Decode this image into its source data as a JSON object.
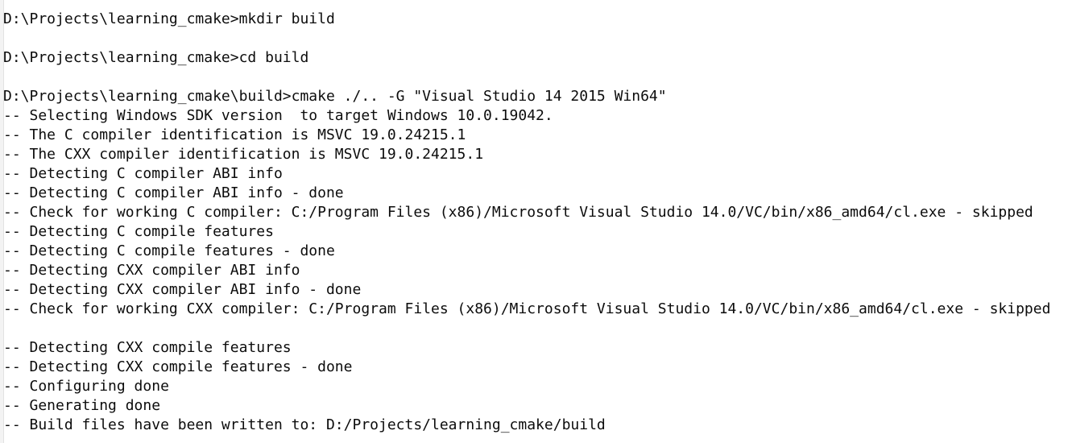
{
  "console": {
    "lines": [
      "D:\\Projects\\learning_cmake>mkdir build",
      "",
      "D:\\Projects\\learning_cmake>cd build",
      "",
      "D:\\Projects\\learning_cmake\\build>cmake ./.. -G \"Visual Studio 14 2015 Win64\"",
      "-- Selecting Windows SDK version  to target Windows 10.0.19042.",
      "-- The C compiler identification is MSVC 19.0.24215.1",
      "-- The CXX compiler identification is MSVC 19.0.24215.1",
      "-- Detecting C compiler ABI info",
      "-- Detecting C compiler ABI info - done",
      "-- Check for working C compiler: C:/Program Files (x86)/Microsoft Visual Studio 14.0/VC/bin/x86_amd64/cl.exe - skipped",
      "-- Detecting C compile features",
      "-- Detecting C compile features - done",
      "-- Detecting CXX compiler ABI info",
      "-- Detecting CXX compiler ABI info - done",
      "-- Check for working CXX compiler: C:/Program Files (x86)/Microsoft Visual Studio 14.0/VC/bin/x86_amd64/cl.exe - skipped",
      "",
      "-- Detecting CXX compile features",
      "-- Detecting CXX compile features - done",
      "-- Configuring done",
      "-- Generating done",
      "-- Build files have been written to: D:/Projects/learning_cmake/build"
    ],
    "colors": {
      "background": "#ffffff",
      "text": "#0c0c0c"
    }
  }
}
